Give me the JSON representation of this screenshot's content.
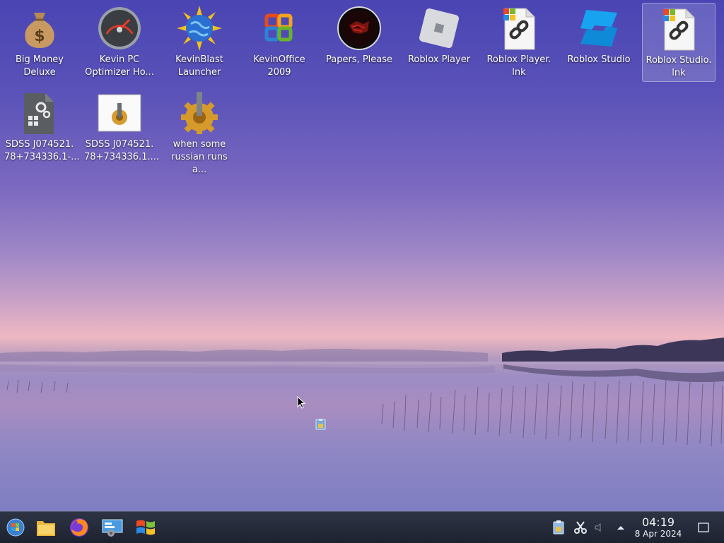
{
  "desktop": {
    "icons": [
      {
        "label": "Big Money\nDeluxe",
        "icon": "money-bag-icon"
      },
      {
        "label": "Kevin PC\nOptimizer Ho...",
        "icon": "speedometer-icon"
      },
      {
        "label": "KevinBlast\nLauncher",
        "icon": "globe-sun-icon"
      },
      {
        "label": "KevinOffice\n2009",
        "icon": "office-logo-icon"
      },
      {
        "label": "Papers, Please",
        "icon": "papers-please-icon"
      },
      {
        "label": "Roblox Player",
        "icon": "roblox-player-icon"
      },
      {
        "label": "Roblox Player.\nlnk",
        "icon": "shortcut-file-icon"
      },
      {
        "label": "Roblox Studio",
        "icon": "roblox-studio-icon"
      },
      {
        "label": "Roblox Studio.\nlnk",
        "icon": "shortcut-file-icon",
        "selected": true
      },
      {
        "label": "SDSS J074521.\n78+734336.1-...",
        "icon": "executable-file-icon"
      },
      {
        "label": "SDSS J074521.\n78+734336.1....",
        "icon": "installer-file-icon"
      },
      {
        "label": "when some\nrussian runs a...",
        "icon": "gear-icon"
      }
    ]
  },
  "taskbar": {
    "pinned": [
      "start-orb-icon",
      "file-manager-icon",
      "firefox-icon",
      "control-panel-icon",
      "windows-logo-icon"
    ],
    "tray": [
      "clipboard-icon",
      "scissors-icon",
      "volume-icon",
      "tray-expand-icon",
      "show-desktop-icon"
    ],
    "clock": {
      "time": "04:19",
      "date": "8 Apr 2024"
    }
  },
  "colors": {
    "taskbar": "#1d2230",
    "label_text": "#ffffff"
  }
}
